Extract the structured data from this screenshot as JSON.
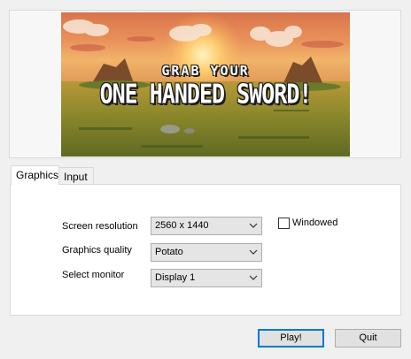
{
  "banner": {
    "line1": "GRAB YOUR",
    "line2": "ONE HANDED SWORD!"
  },
  "tabs": [
    {
      "label": "Graphics",
      "active": true
    },
    {
      "label": "Input",
      "active": false
    }
  ],
  "graphics": {
    "resolution": {
      "label": "Screen resolution",
      "value": "2560 x 1440"
    },
    "quality": {
      "label": "Graphics quality",
      "value": "Potato"
    },
    "monitor": {
      "label": "Select monitor",
      "value": "Display 1"
    },
    "windowed": {
      "label": "Windowed",
      "checked": false
    }
  },
  "buttons": {
    "play": "Play!",
    "quit": "Quit"
  }
}
